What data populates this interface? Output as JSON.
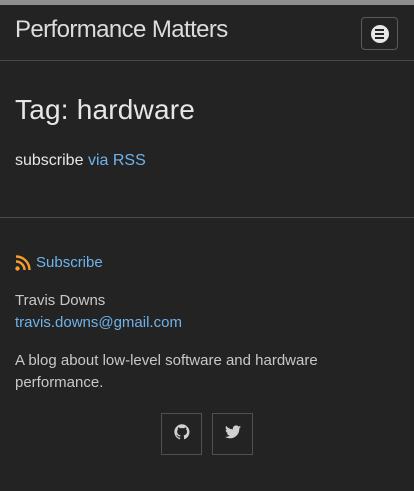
{
  "header": {
    "site_title": "Performance Matters",
    "menu_icon": "hamburger-menu-icon"
  },
  "main": {
    "page_title": "Tag: hardware",
    "subscribe_prefix": "subscribe",
    "subscribe_link": "via RSS"
  },
  "footer": {
    "subscribe_icon": "rss-icon",
    "subscribe_label": "Subscribe",
    "author_name": "Travis Downs",
    "author_email": "travis.downs@gmail.com",
    "description": "A blog about low-level software and hardware performance.",
    "social": [
      {
        "icon": "github-icon"
      },
      {
        "icon": "twitter-icon"
      }
    ]
  },
  "colors": {
    "background": "#232323",
    "link": "#6fb3ec",
    "rss": "#f79c2f",
    "text": "#e6e6e6"
  }
}
